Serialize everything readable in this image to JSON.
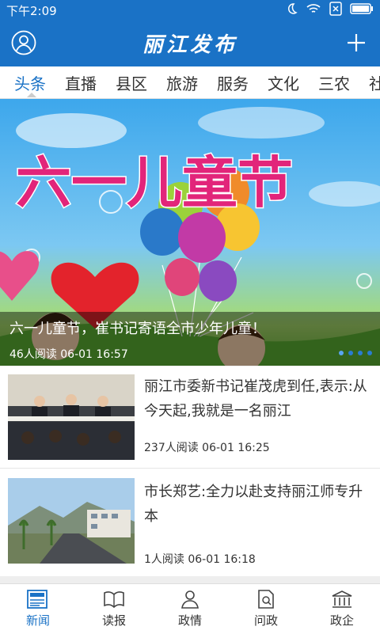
{
  "status_bar": {
    "time": "下午2:09"
  },
  "app_bar": {
    "title": "丽江发布"
  },
  "tabs": [
    "头条",
    "直播",
    "县区",
    "旅游",
    "服务",
    "文化",
    "三农",
    "社"
  ],
  "hero": {
    "banner_text": "六一儿童节",
    "title": "六一儿童节，崔书记寄语全市少年儿童！",
    "meta": "46人阅读   06-01 16:57"
  },
  "news": [
    {
      "headline": "丽江市委新书记崔茂虎到任,表示:从今天起,我就是一名丽江",
      "meta": "237人阅读   06-01 16:25"
    },
    {
      "headline": "市长郑艺:全力以赴支持丽江师专升本",
      "meta": "1人阅读   06-01 16:18"
    }
  ],
  "bottom_nav": [
    "新闻",
    "读报",
    "政情",
    "问政",
    "政企"
  ],
  "colors": {
    "primary": "#1a72c6"
  }
}
